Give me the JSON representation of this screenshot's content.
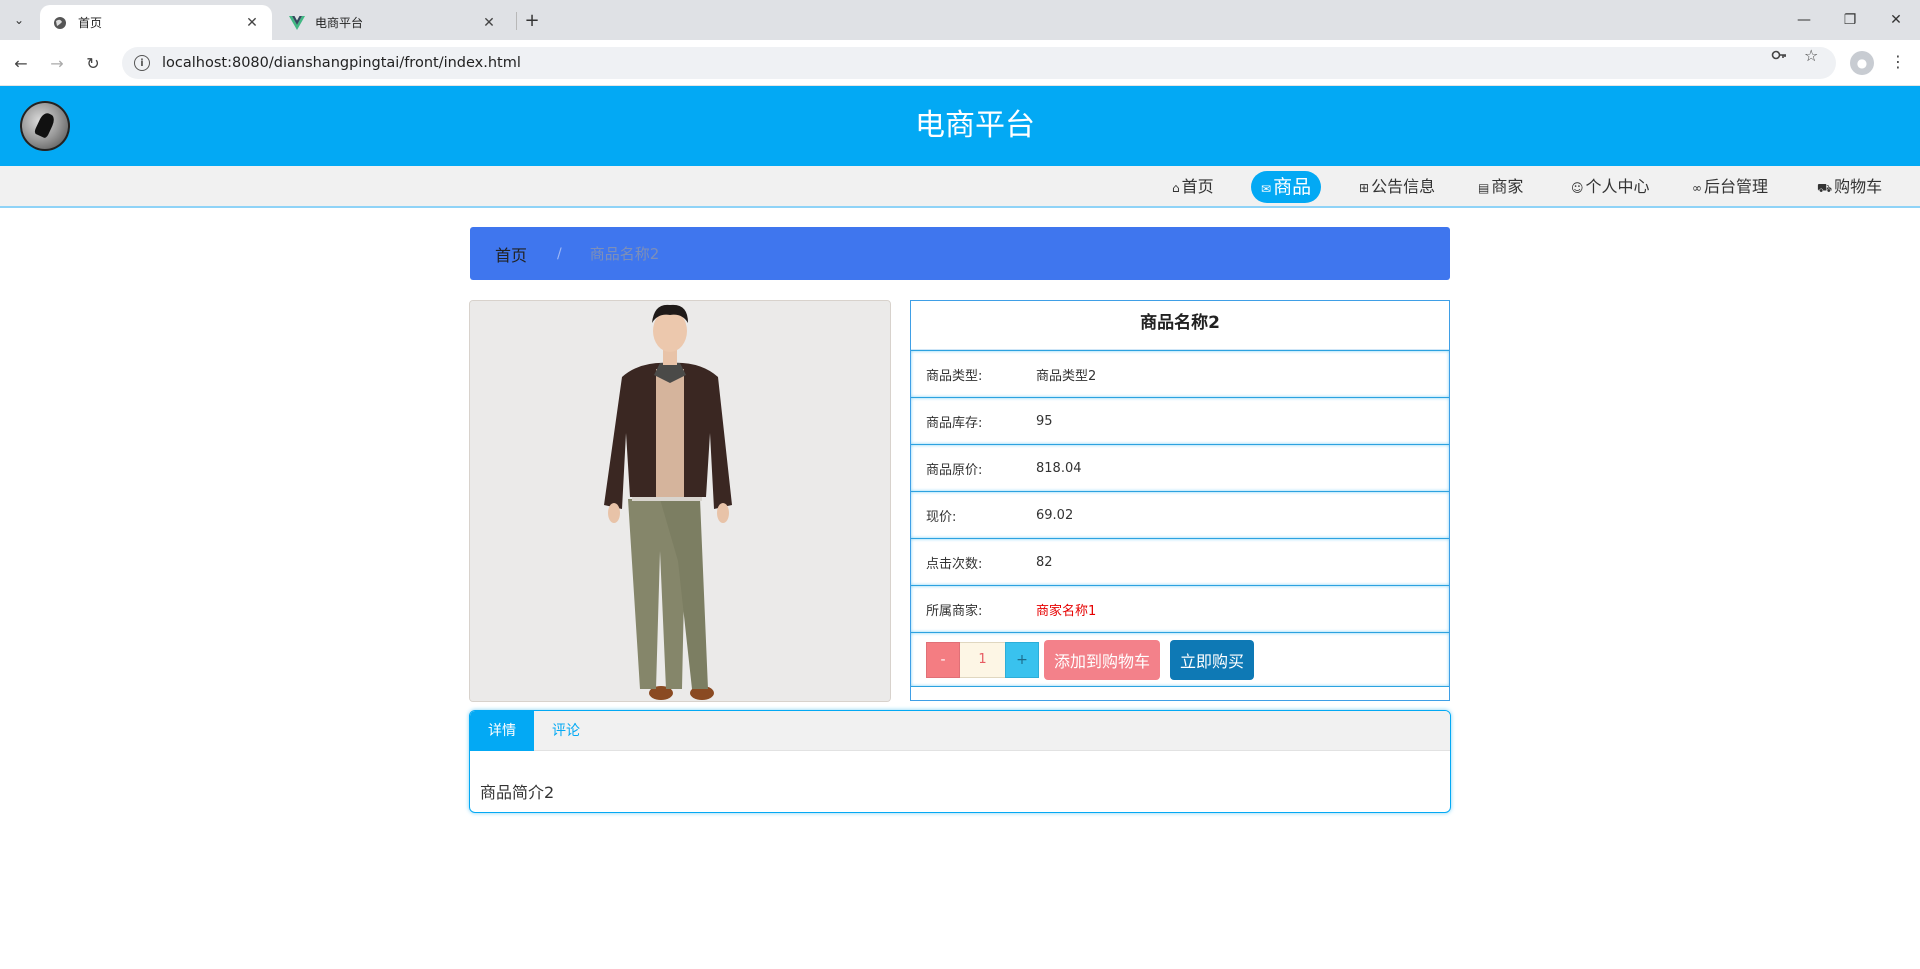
{
  "browser": {
    "tabs": [
      {
        "title": "首页",
        "active": true
      },
      {
        "title": "电商平台",
        "active": false
      }
    ],
    "url": "localhost:8080/dianshangpingtai/front/index.html"
  },
  "site": {
    "title": "电商平台",
    "accent_color": "#03a9f4",
    "menu": [
      {
        "label": "首页",
        "icon": "home-icon"
      },
      {
        "label": "商品",
        "icon": "mail-icon",
        "active": true
      },
      {
        "label": "公告信息",
        "icon": "gift-icon"
      },
      {
        "label": "商家",
        "icon": "calendar-icon"
      },
      {
        "label": "个人中心",
        "icon": "user-icon"
      },
      {
        "label": "后台管理",
        "icon": "link-icon"
      },
      {
        "label": "购物车",
        "icon": "cart-icon"
      }
    ]
  },
  "breadcrumb": {
    "home": "首页",
    "separator": "/",
    "current": "商品名称2"
  },
  "product": {
    "name": "商品名称2",
    "fields": [
      {
        "label": "商品类型:",
        "value": "商品类型2"
      },
      {
        "label": "商品库存:",
        "value": "95"
      },
      {
        "label": "商品原价:",
        "value": "818.04"
      },
      {
        "label": "现价:",
        "value": "69.02"
      },
      {
        "label": "点击次数:",
        "value": "82"
      },
      {
        "label": "所属商家:",
        "value": "商家名称1"
      }
    ],
    "quantity": {
      "minus": "-",
      "value": "1",
      "plus": "+"
    },
    "add_to_cart": "添加到购物车",
    "buy_now": "立即购买"
  },
  "tabs": {
    "items": [
      {
        "label": "详情",
        "active": true
      },
      {
        "label": "评论",
        "active": false
      }
    ],
    "content": "商品简介2"
  }
}
